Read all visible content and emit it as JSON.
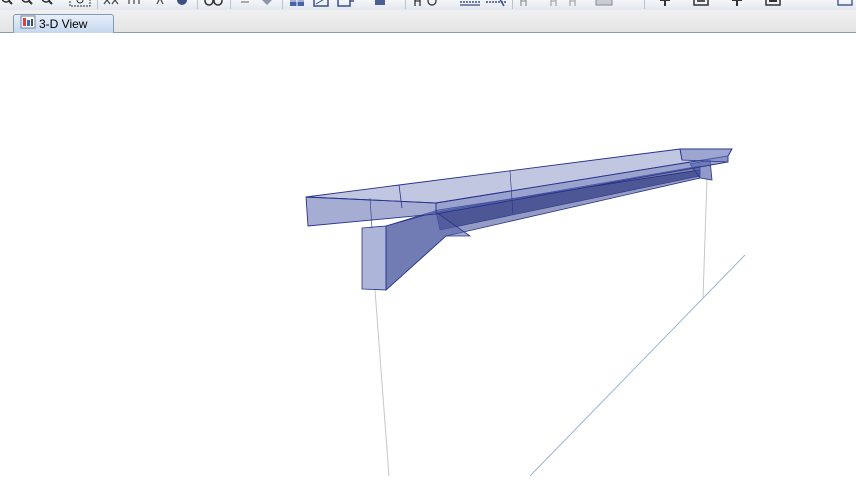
{
  "toolbar": {
    "buttons": [
      {
        "icon": "zoom-in-icon"
      },
      {
        "icon": "zoom-out-icon"
      },
      {
        "icon": "zoom-previous-icon"
      },
      {
        "icon": "zoom-extents-icon"
      },
      {
        "icon": "pan-icon"
      },
      {
        "icon": "rotate-icon"
      },
      {
        "icon": "refresh-icon"
      },
      {
        "icon": "view-options-icon"
      },
      {
        "icon": "move-up-icon"
      },
      {
        "icon": "move-down-icon"
      },
      {
        "icon": "select-icon"
      },
      {
        "icon": "grid-icon"
      },
      {
        "icon": "section-icon"
      },
      {
        "icon": "properties-icon"
      },
      {
        "icon": "text-icon"
      },
      {
        "icon": "dimension-icon"
      },
      {
        "icon": "measure-icon"
      },
      {
        "icon": "draw-icon"
      },
      {
        "icon": "print-icon"
      }
    ]
  },
  "tabs": [
    {
      "label": "3-D View",
      "icon": "3d-view-icon",
      "active": true
    }
  ],
  "colors": {
    "beam_fill": "#3c4a94",
    "beam_edge": "#27338a",
    "support_line": "#bfbfbf",
    "grid_line": "#9db4d2"
  }
}
